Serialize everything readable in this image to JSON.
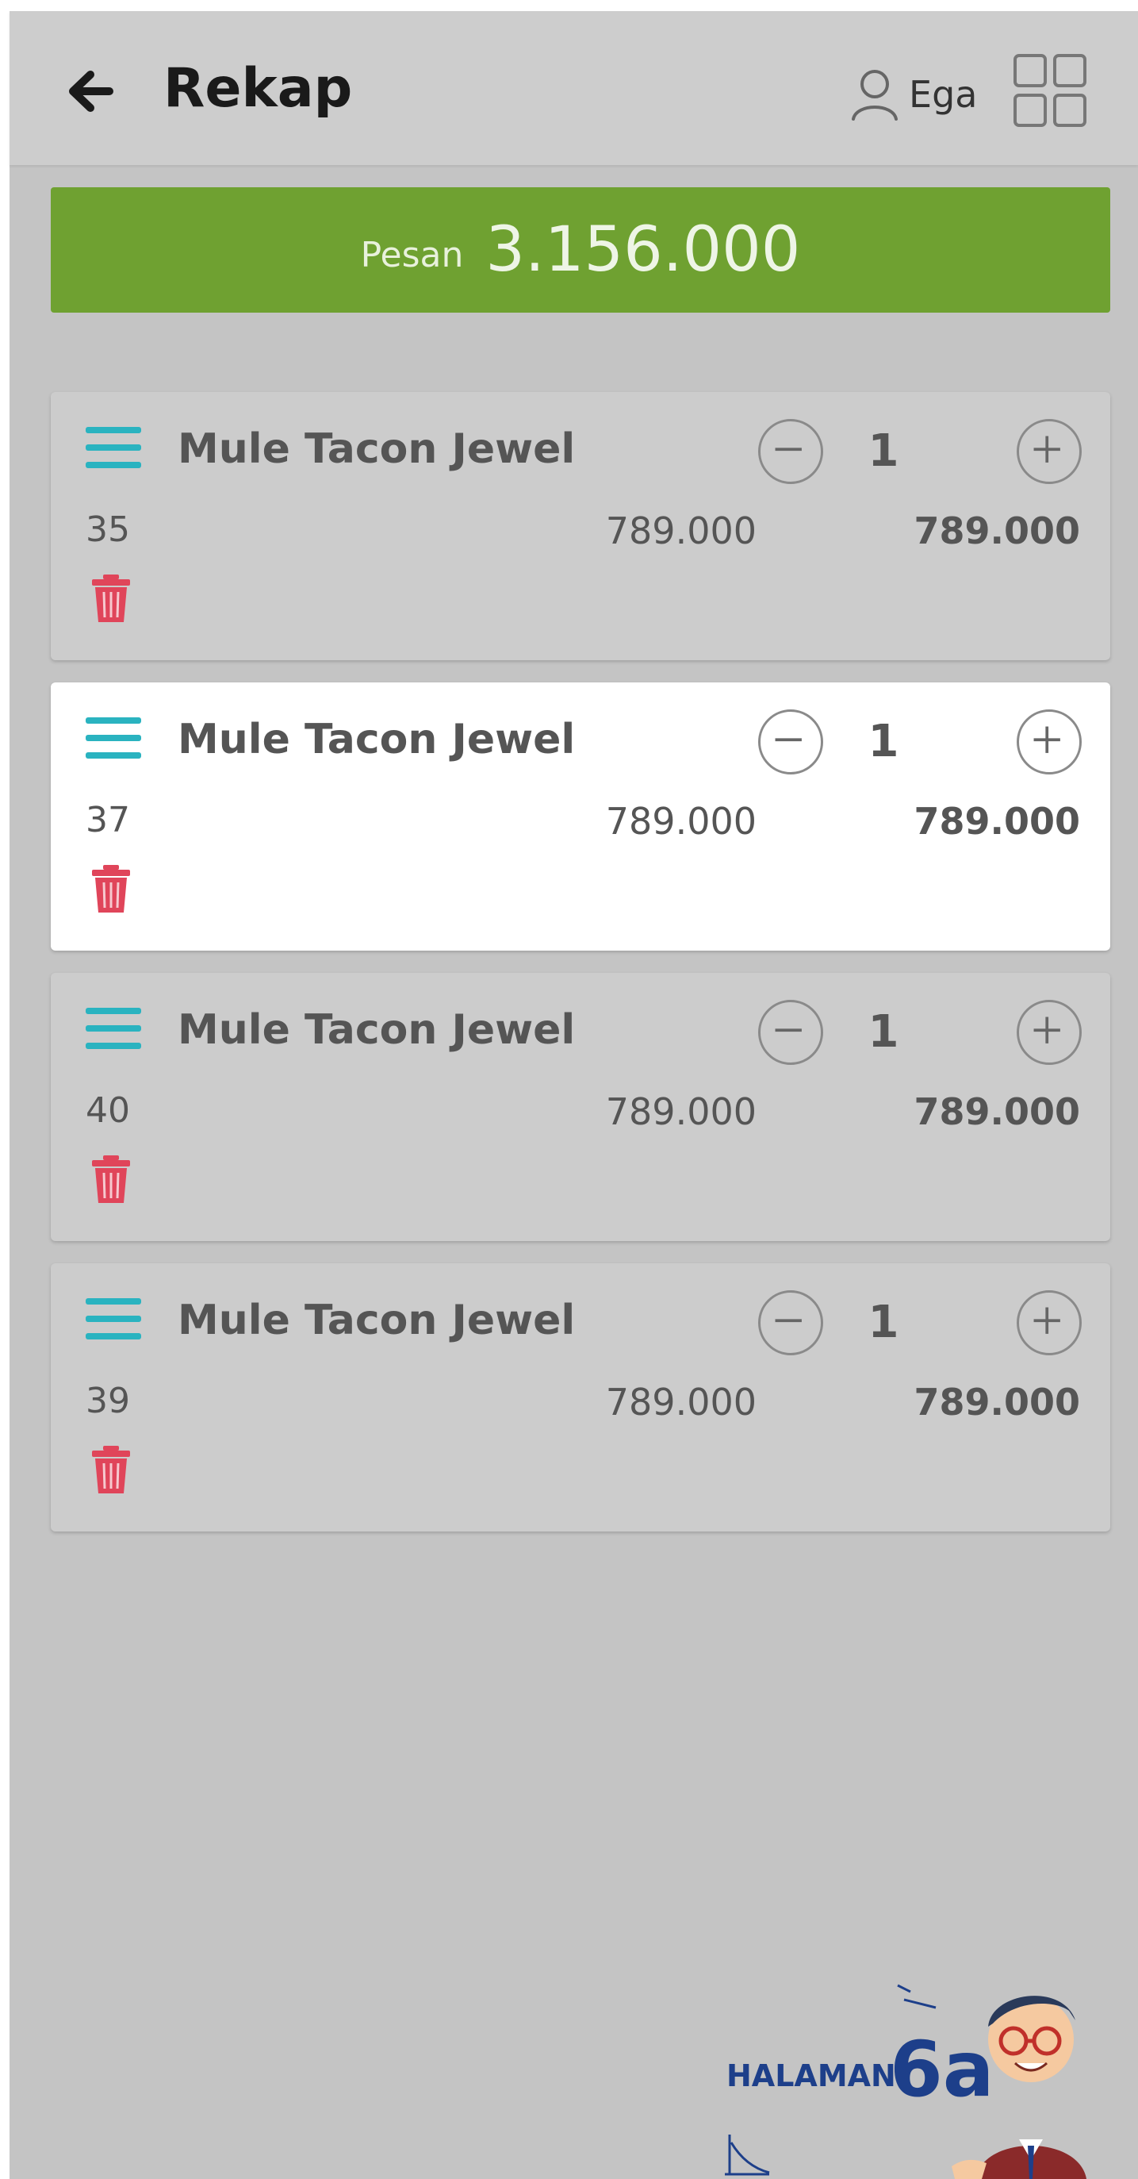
{
  "header": {
    "title": "Rekap",
    "user_name": "Ega"
  },
  "order_total": {
    "label": "Pesan",
    "value": "3.156.000"
  },
  "items": [
    {
      "name": "Mule Tacon Jewel",
      "qty": "1",
      "size": "35",
      "price": "789.000",
      "subtotal": "789.000"
    },
    {
      "name": "Mule Tacon Jewel",
      "qty": "1",
      "size": "37",
      "price": "789.000",
      "subtotal": "789.000"
    },
    {
      "name": "Mule Tacon Jewel",
      "qty": "1",
      "size": "40",
      "price": "789.000",
      "subtotal": "789.000"
    },
    {
      "name": "Mule Tacon Jewel",
      "qty": "1",
      "size": "39",
      "price": "789.000",
      "subtotal": "789.000"
    }
  ],
  "watermark": {
    "label": "HALAMAN",
    "number": "6a"
  },
  "colors": {
    "accent_green": "#6fa131",
    "teal_icon": "#2ab3c0",
    "trash_red": "#e0455a",
    "brand_blue": "#1d3f8a"
  },
  "icons": [
    "back-arrow-icon",
    "user-icon",
    "grid-icon",
    "drag-handle-icon",
    "minus-icon",
    "plus-icon",
    "trash-icon"
  ]
}
